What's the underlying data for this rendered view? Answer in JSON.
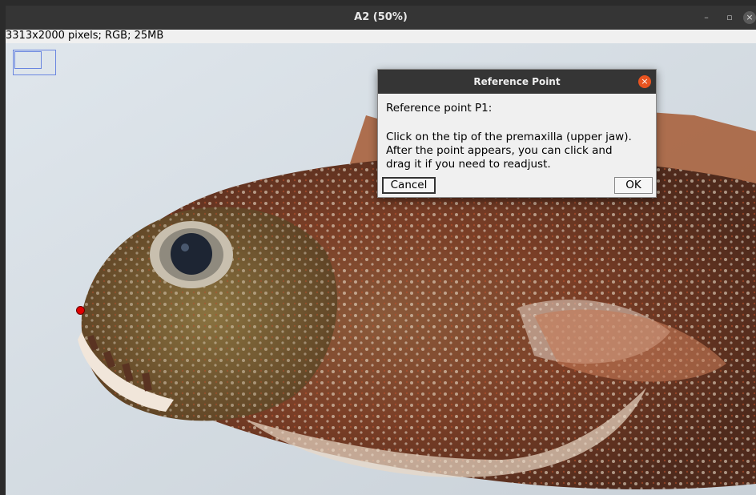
{
  "window": {
    "title": "A2 (50%)",
    "controls": {
      "minimize": "–",
      "maximize": "▫",
      "close": "×"
    }
  },
  "image_info": "3313x2000 pixels; RGB; 25MB",
  "dialog": {
    "title": "Reference Point",
    "close_glyph": "×",
    "heading": "Reference point P1:",
    "instruction_lines": [
      "Click on the tip of the premaxilla (upper jaw).",
      "After the point appears, you can click and",
      "drag it if you need to readjust."
    ],
    "cancel_label": "Cancel",
    "ok_label": "OK"
  },
  "colors": {
    "title_bar": "#353535",
    "dialog_close": "#e95420",
    "marker": "#e00000",
    "nav_rect": "#6a86e0"
  }
}
